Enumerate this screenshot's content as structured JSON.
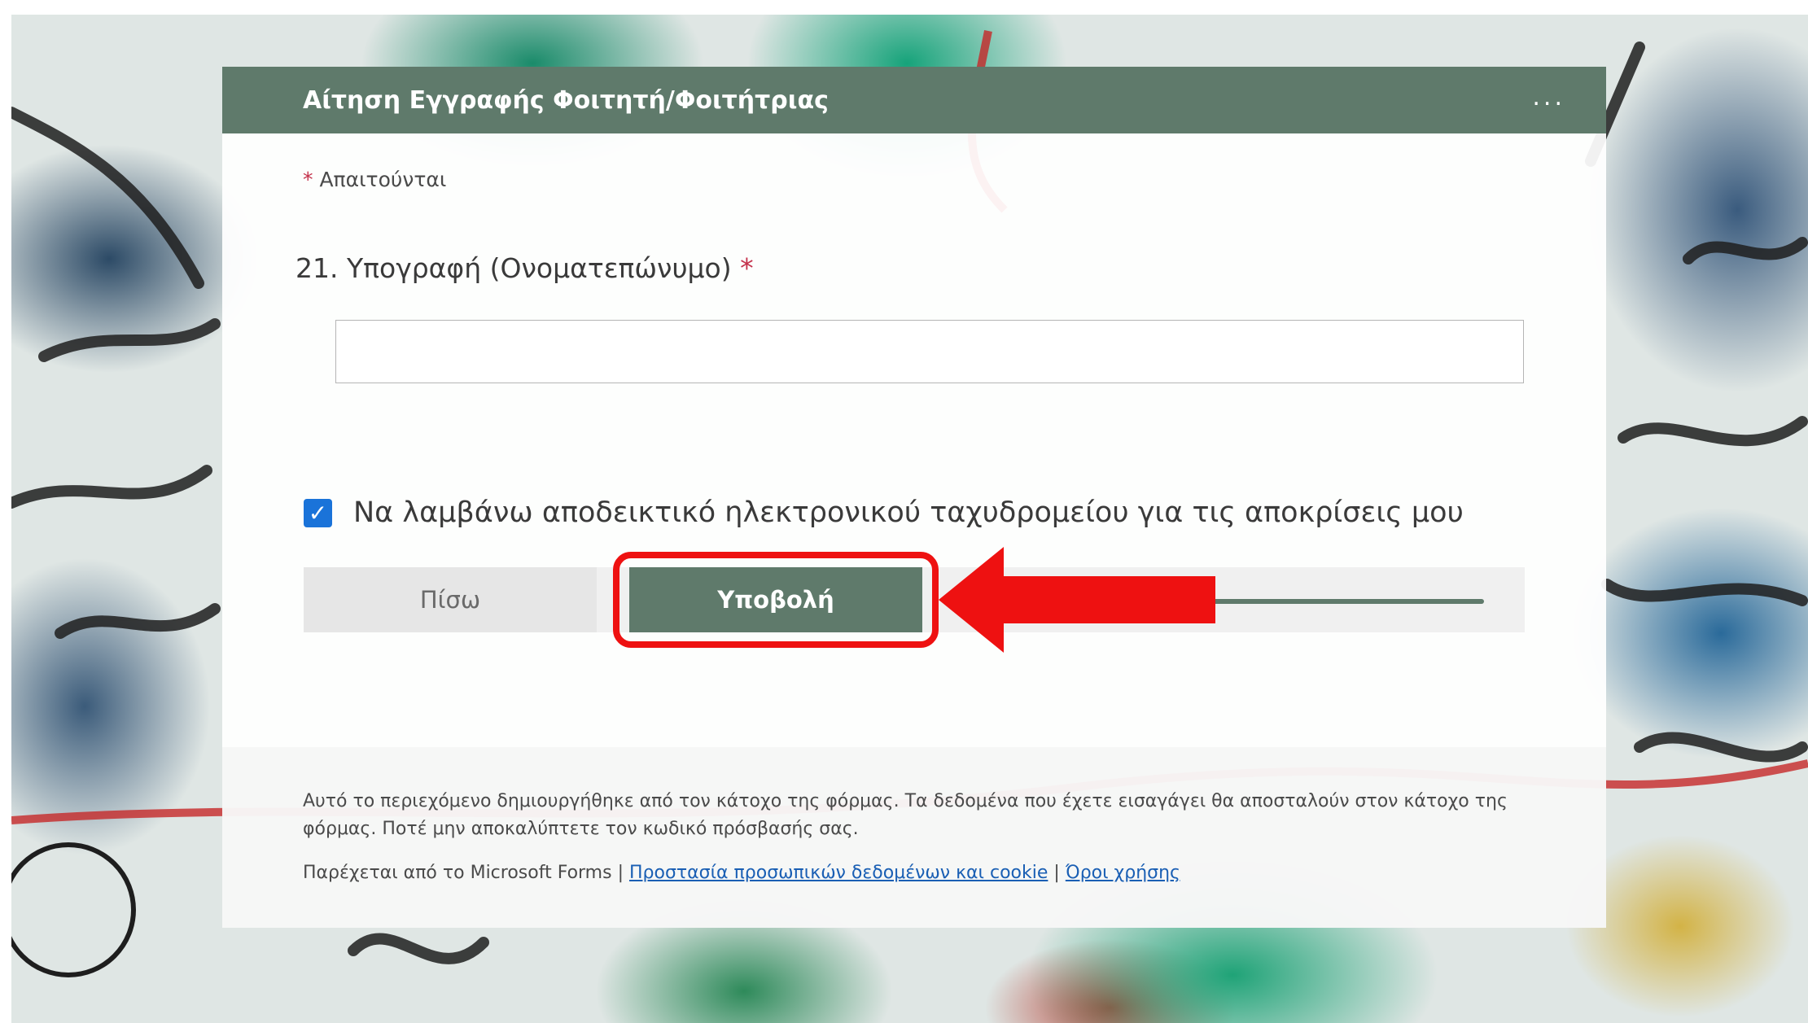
{
  "form": {
    "title": "Αίτηση Εγγραφής Φοιτητή/Φοιτήτριας",
    "more_label": "...",
    "required_asterisk": "*",
    "required_note": "Απαιτούνται",
    "question": {
      "number": "21.",
      "label": "Υπογραφή (Ονοματεπώνυμο)",
      "asterisk": "*",
      "value": ""
    },
    "receipt": {
      "checked": true,
      "check_glyph": "✓",
      "label": "Να λαμβάνω αποδεικτικό ηλεκτρονικού ταχυδρομείου για τις αποκρίσεις μου"
    },
    "buttons": {
      "back": "Πίσω",
      "submit": "Υποβολή"
    }
  },
  "footer": {
    "disclaimer": "Αυτό το περιεχόμενο δημιουργήθηκε από τον κάτοχο της φόρμας. Τα δεδομένα που έχετε εισαγάγει θα αποσταλούν στον κάτοχο της φόρμας. Ποτέ μην αποκαλύπτετε τον κωδικό πρόσβασής σας.",
    "provided_by": "Παρέχεται από το Microsoft Forms |",
    "privacy_link": "Προστασία προσωπικών δεδομένων και cookie",
    "separator": "|",
    "terms_link": "Όροι χρήσης"
  },
  "colors": {
    "header": "#5f7a6b",
    "accent_check": "#1a73d9",
    "annotation": "#ee1111"
  }
}
